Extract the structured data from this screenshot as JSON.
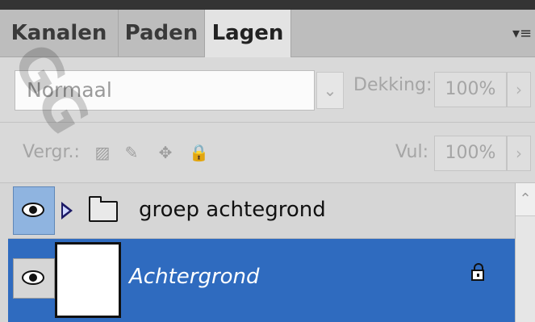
{
  "tabs": [
    {
      "label": "Kanalen",
      "active": false
    },
    {
      "label": "Paden",
      "active": false
    },
    {
      "label": "Lagen",
      "active": true
    }
  ],
  "panel_menu_icon": "panel-menu-icon",
  "blend_mode": {
    "value": "Normaal"
  },
  "opacity": {
    "label": "Dekking:",
    "value": "100%"
  },
  "lock": {
    "label": "Vergr.:",
    "icons": [
      "lock-transparent-icon",
      "brush-icon",
      "move-icon",
      "lock-icon"
    ]
  },
  "fill": {
    "label": "Vul:",
    "value": "100%"
  },
  "layers": [
    {
      "name": "groep achtegrond",
      "type": "group",
      "visible": true,
      "selected": false
    },
    {
      "name": "Achtergrond",
      "type": "layer",
      "visible": true,
      "selected": true,
      "locked": true
    }
  ],
  "watermark": {
    "text": "GG"
  },
  "colors": {
    "selected": "#2f6bbf",
    "eye_highlight": "#8fb4e0"
  }
}
